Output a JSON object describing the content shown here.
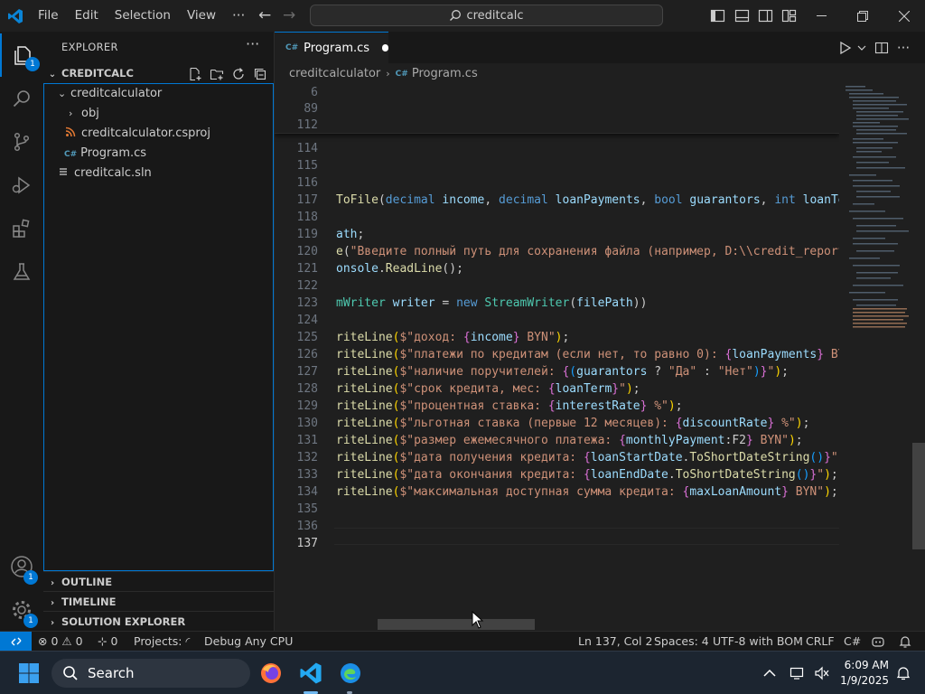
{
  "titlebar": {
    "menu": [
      "File",
      "Edit",
      "Selection",
      "View"
    ],
    "more": "···",
    "search_text": "creditcalc"
  },
  "activity": {
    "explorer_badge": "1",
    "accounts_badge": "1",
    "manage_badge": "1"
  },
  "sidebar": {
    "title": "EXPLORER",
    "more": "···",
    "workspace": "CREDITCALC",
    "tree": [
      {
        "label": "creditcalculator",
        "chevron": "⌄"
      },
      {
        "label": "obj",
        "chevron": "›"
      },
      {
        "label": "creditcalculator.csproj"
      },
      {
        "label": "Program.cs",
        "icon_text": "C#"
      },
      {
        "label": "creditcalc.sln"
      }
    ],
    "sections": [
      "OUTLINE",
      "TIMELINE",
      "SOLUTION EXPLORER"
    ]
  },
  "editor": {
    "tab_label": "Program.cs",
    "breadcrumb": [
      "creditcalculator",
      "Program.cs"
    ],
    "sticky_lines": [
      "6",
      "89",
      "112"
    ],
    "line_numbers": [
      "114",
      "115",
      "116",
      "117",
      "118",
      "119",
      "120",
      "121",
      "122",
      "123",
      "124",
      "125",
      "126",
      "127",
      "128",
      "129",
      "130",
      "131",
      "132",
      "133",
      "134",
      "135",
      "136",
      "137"
    ],
    "current_line": "137"
  },
  "statusbar": {
    "errors": "0",
    "warnings": "0",
    "ports": "0",
    "projects": "Projects:",
    "debug": "Debug Any CPU",
    "cursor": "Ln 137, Col 2",
    "spaces": "Spaces: 4",
    "encoding": "UTF-8 with BOM",
    "eol": "CRLF",
    "language": "C#"
  },
  "taskbar": {
    "search_label": "Search",
    "time": "6:09 AM",
    "date": "1/9/2025"
  },
  "colors": {
    "accent": "#0078d4",
    "editor_bg": "#1f1f1f",
    "sidebar_bg": "#181818",
    "keyword": "#569cd6",
    "type": "#4ec9b0",
    "string": "#ce9178",
    "method": "#dcdcaa",
    "variable": "#9cdcfe"
  }
}
